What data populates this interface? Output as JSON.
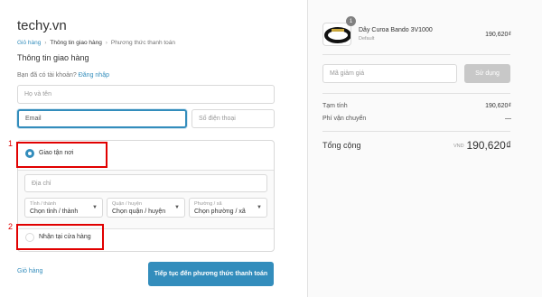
{
  "store": {
    "name": "techy.vn"
  },
  "breadcrumb": {
    "items": [
      {
        "label": "Giỏ hàng",
        "state": "link"
      },
      {
        "label": "Thông tin giao hàng",
        "state": "current"
      },
      {
        "label": "Phương thức thanh toán",
        "state": "upcoming"
      }
    ],
    "separator": "›"
  },
  "section": {
    "title": "Thông tin giao hàng"
  },
  "login_prompt": {
    "text": "Bạn đã có tài khoản?",
    "link": "Đăng nhập"
  },
  "form": {
    "name_placeholder": "Họ và tên",
    "email_placeholder": "Email",
    "phone_placeholder": "Số điện thoại"
  },
  "shipping": {
    "delivery_label": "Giao tận nơi",
    "address_placeholder": "Địa chỉ",
    "province": {
      "label": "Tỉnh / thành",
      "value": "Chọn tỉnh / thành"
    },
    "district": {
      "label": "Quận / huyện",
      "value": "Chọn quận / huyện"
    },
    "ward": {
      "label": "Phường / xã",
      "value": "Chọn phường / xã"
    },
    "pickup_label": "Nhận tại cửa hàng"
  },
  "annotations": {
    "first": "1",
    "second": "2"
  },
  "footer": {
    "back_link": "Giỏ hàng",
    "continue_button": "Tiếp tục đến phương thức thanh toán"
  },
  "order": {
    "product": {
      "name": "Dây Curoa Bando 3V1000",
      "variant": "Default",
      "price": "190,620₫",
      "quantity": "1"
    },
    "discount": {
      "placeholder": "Mã giảm giá",
      "button": "Sử dụng"
    },
    "subtotal": {
      "label": "Tạm tính",
      "value": "190,620₫"
    },
    "shipping_fee": {
      "label": "Phí vận chuyển",
      "value": "—"
    },
    "total": {
      "label": "Tổng cộng",
      "currency": "VND",
      "value": "190,620₫"
    }
  },
  "colors": {
    "accent": "#338dbc",
    "annotation": "#e10000",
    "disabled_button": "#c8c8c8"
  }
}
